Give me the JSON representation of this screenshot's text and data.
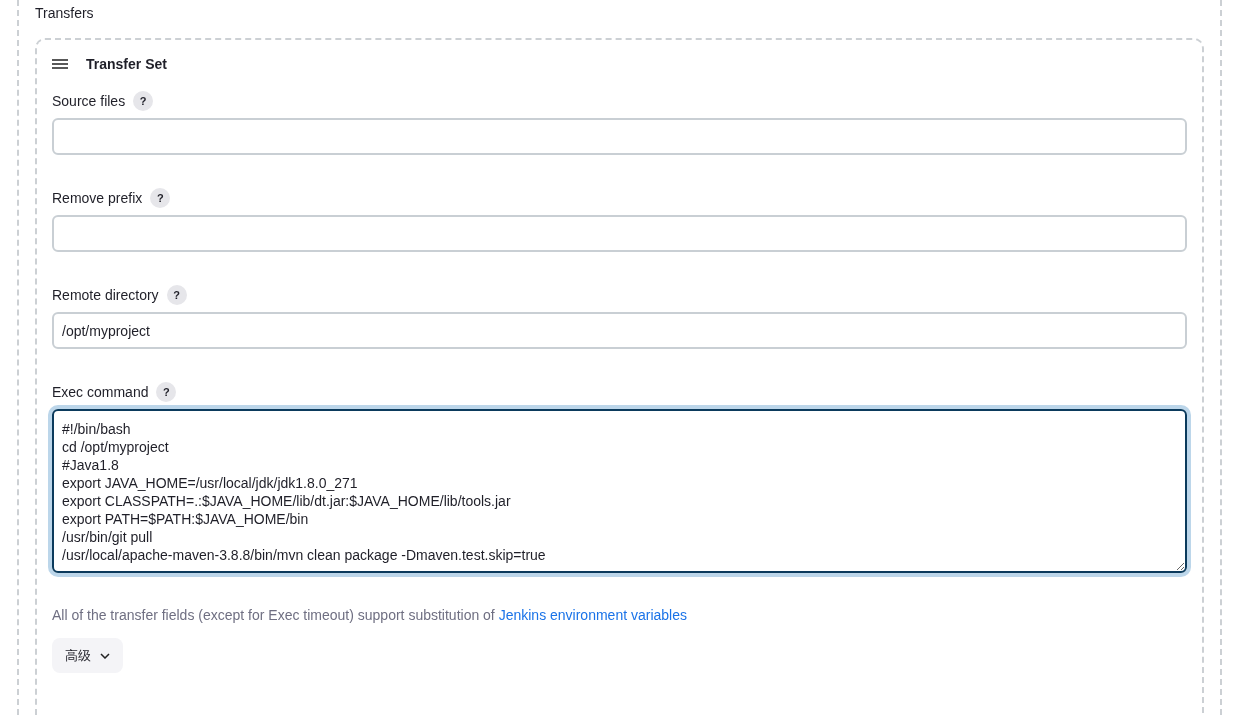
{
  "section_title": "Transfers",
  "transfer_set": {
    "title": "Transfer Set",
    "fields": [
      {
        "kind": "input",
        "label": "Source files",
        "help": "?"
      },
      {
        "kind": "input",
        "label": "Remove prefix",
        "help": "?"
      },
      {
        "kind": "input",
        "label": "Remote directory",
        "help": "?",
        "value": "/opt/myproject"
      },
      {
        "kind": "textarea",
        "label": "Exec command",
        "help": "?",
        "focused": true,
        "value": "#!/bin/bash\ncd /opt/myproject\n#Java1.8\nexport JAVA_HOME=/usr/local/jdk/jdk1.8.0_271\nexport CLASSPATH=.:$JAVA_HOME/lib/dt.jar:$JAVA_HOME/lib/tools.jar\nexport PATH=$PATH:$JAVA_HOME/bin\n/usr/bin/git pull\n/usr/local/apache-maven-3.8.8/bin/mvn clean package -Dmaven.test.skip=true"
      }
    ],
    "note": {
      "text": "All of the transfer fields (except for Exec timeout) support substitution of ",
      "link": "Jenkins environment variables"
    },
    "advanced_button": "高级"
  }
}
